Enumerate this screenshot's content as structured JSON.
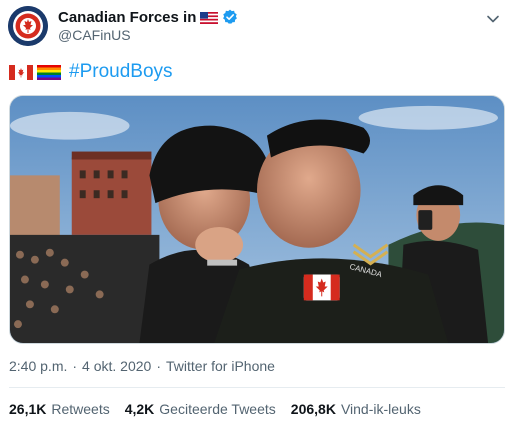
{
  "header": {
    "display_name": "Canadian Forces in",
    "handle": "@CAFinUS",
    "avatar_icon": "canadian-forces-roundel-icon",
    "country_flag_icon": "us-flag-icon",
    "verified_icon": "verified-badge-icon",
    "more_icon": "chevron-down-icon"
  },
  "tweet": {
    "emoji_icons": [
      "canada-flag-icon",
      "rainbow-flag-icon"
    ],
    "hashtag": "#ProudBoys"
  },
  "photo": {
    "badge_text": "CANADA"
  },
  "meta": {
    "time": "2:40 p.m.",
    "separator1": "·",
    "date": "4 okt. 2020",
    "separator2": "·",
    "source": "Twitter for iPhone"
  },
  "stats": {
    "retweets_count": "26,1K",
    "retweets_label": "Retweets",
    "quotes_count": "4,2K",
    "quotes_label": "Geciteerde Tweets",
    "likes_count": "206,8K",
    "likes_label": "Vind-ik-leuks"
  },
  "colors": {
    "link": "#1d9bf0",
    "muted": "#536471",
    "text": "#0f1419",
    "divider": "#e6ecf0"
  }
}
